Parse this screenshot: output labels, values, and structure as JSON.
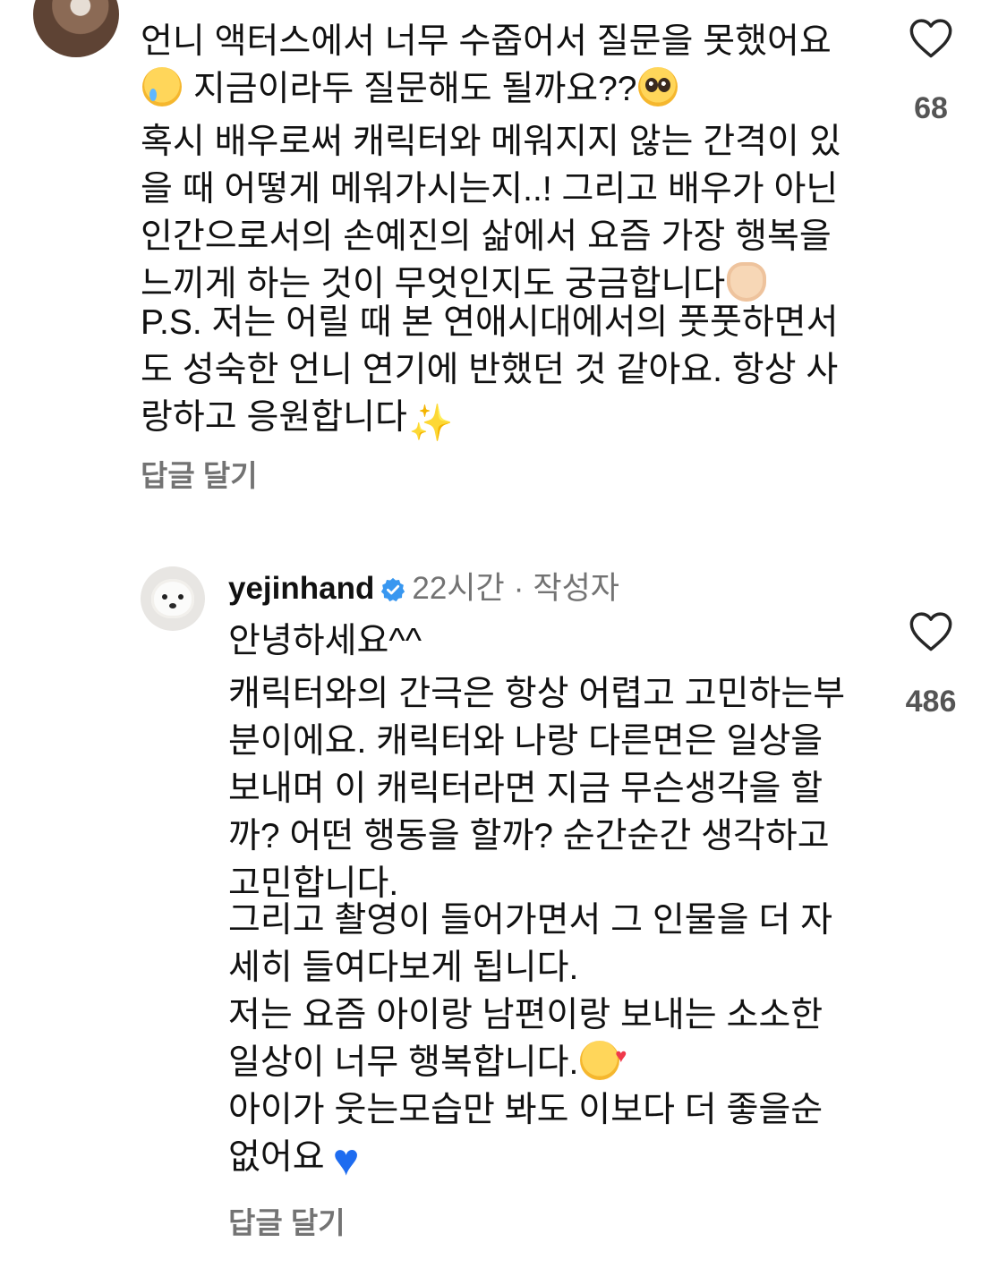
{
  "comment": {
    "lines_p1": [
      "언니 액터스에서 너무 수줍어서 질문을 못했어요",
      "지금이라두 질문해도 될까요??"
    ],
    "emoji_p1": [
      "crying-face",
      "pleading-face"
    ],
    "lines_p2": [
      "혹시 배우로써 캐릭터와 메워지지 않는 간격이 있",
      "을 때 어떻게 메워가시는지..! 그리고 배우가 아닌",
      "인간으로서의 손예진의 삶에서 요즘 가장 행복을",
      "느끼게 하는 것이 무엇인지도 궁금합니다"
    ],
    "emoji_p2": "heart-hands",
    "lines_p3": [
      "P.S. 저는 어릴 때 본 연애시대에서의 풋풋하면서",
      "도 성숙한 언니 연기에 반했던 것 같아요. 항상 사",
      "랑하고 응원합니다"
    ],
    "emoji_p3": "sparkles",
    "reply_label": "답글 달기",
    "like_count": "68"
  },
  "reply": {
    "username": "yejinhand",
    "time": "22시간",
    "separator": "·",
    "role": "작성자",
    "greeting": "안녕하세요^^",
    "lines_p1": [
      "캐릭터와의 간극은 항상 어렵고 고민하는부",
      "분이에요. 캐릭터와 나랑 다른면은 일상을",
      "보내며 이 캐릭터라면 지금 무슨생각을 할",
      "까? 어떤 행동을 할까? 순간순간 생각하고",
      "고민합니다."
    ],
    "lines_p2": [
      "그리고 촬영이 들어가면서 그 인물을 더 자",
      "세히 들여다보게 됩니다."
    ],
    "lines_p3": [
      "저는 요즘 아이랑 남편이랑 보내는 소소한",
      "일상이 너무 행복합니다.",
      "아이가 웃는모습만 봐도 이보다 더 좋을순",
      "없어요"
    ],
    "emoji_p3": [
      "smiling-face-with-hearts",
      "blue-heart"
    ],
    "reply_label": "답글 달기",
    "like_count": "486"
  },
  "colors": {
    "text": "#111111",
    "secondary": "#737373",
    "verified": "#3897f0"
  }
}
